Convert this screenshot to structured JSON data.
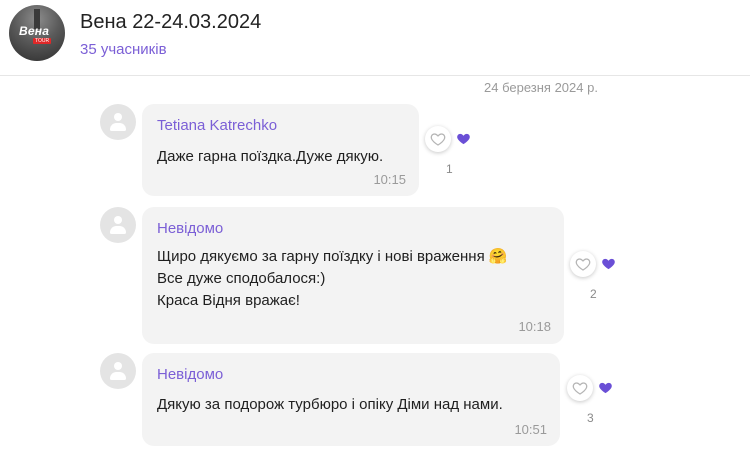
{
  "header": {
    "group_name": "Вена 22-24.03.2024",
    "members": "35 учасників",
    "avatar_text": "Вена",
    "avatar_subtext": "TOUR"
  },
  "chat": {
    "date_separator": "24 березня 2024 р.",
    "messages": [
      {
        "sender": "Tetiana Katrechko",
        "lines": [
          "Даже гарна поїздка.Дуже дякую."
        ],
        "time": "10:15",
        "reaction_count": "1"
      },
      {
        "sender": "Невідомо",
        "lines": [
          "Щиро дякуємо за гарну поїздку і нові враження",
          "Все дуже сподобалося:)",
          "Краса Відня вражає!"
        ],
        "emoji": "🤗",
        "time": "10:18",
        "reaction_count": "2"
      },
      {
        "sender": "Невідомо",
        "lines": [
          "Дякую за подорож турбюро і опіку Діми над нами."
        ],
        "time": "10:51",
        "reaction_count": "3"
      }
    ]
  },
  "colors": {
    "accent": "#7b5fd6",
    "bubble": "#f3f3f3",
    "muted": "#9a9a9a"
  },
  "icons": {
    "default_avatar": "user-placeholder-icon",
    "react": "heart-outline-icon",
    "reaction": "heart-filled-icon"
  }
}
